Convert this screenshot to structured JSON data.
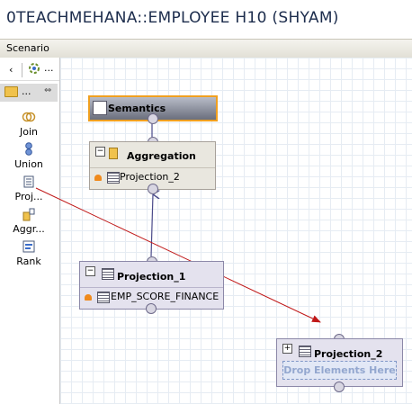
{
  "window": {
    "title": "0TEACHMEHANA::EMPLOYEE H10 (SHYAM)"
  },
  "scenario_bar": {
    "label": "Scenario"
  },
  "palette": {
    "toolbar": {
      "back_icon": "‹",
      "tool_icon": "palette-tool-icon",
      "more": "..."
    },
    "drawer": {
      "more": "...",
      "collapse": "⇔"
    },
    "items": [
      {
        "label": "Join",
        "icon": "join-icon"
      },
      {
        "label": "Union",
        "icon": "union-icon"
      },
      {
        "label": "Proj...",
        "icon": "projection-icon"
      },
      {
        "label": "Aggr...",
        "icon": "aggregation-icon"
      },
      {
        "label": "Rank",
        "icon": "rank-icon"
      }
    ]
  },
  "canvas": {
    "semantics": {
      "title": "Semantics"
    },
    "aggregation": {
      "title": "Aggregation",
      "expander": "−",
      "row": "Projection_2"
    },
    "projection_1": {
      "title": "Projection_1",
      "expander": "−",
      "row": "EMP_SCORE_FINANCE"
    },
    "projection_2": {
      "title": "Projection_2",
      "expander": "+",
      "drop_text": "Drop Elements Here"
    }
  },
  "colors": {
    "arrow": "#c01818",
    "connector": "#4a4a8a",
    "semantics_accent": "#f0a020"
  }
}
